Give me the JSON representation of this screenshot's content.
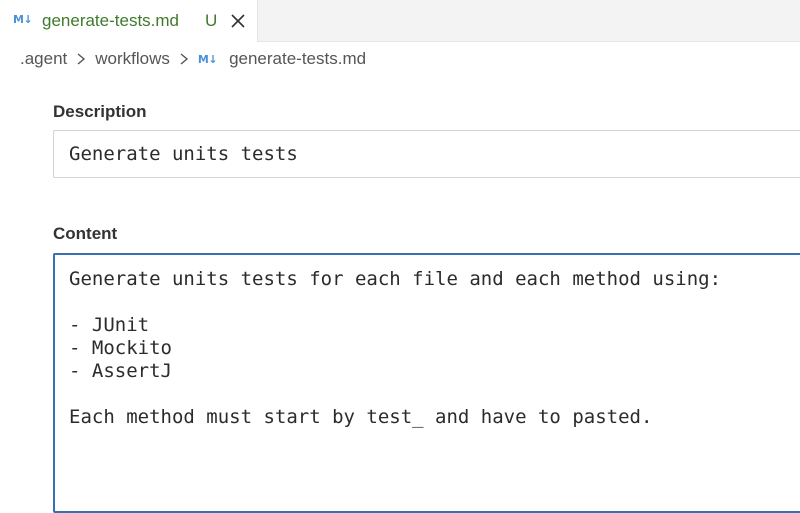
{
  "tab": {
    "icon": "M↓",
    "title": "generate-tests.md",
    "status": "U"
  },
  "breadcrumb": {
    "items": [
      ".agent",
      "workflows"
    ],
    "icon": "M↓",
    "file": "generate-tests.md"
  },
  "description": {
    "label": "Description",
    "value": "Generate units tests"
  },
  "content": {
    "label": "Content",
    "value": "Generate units tests for each file and each method using:\n\n- JUnit\n- Mockito\n- AssertJ\n\nEach method must start by test_ and have to pasted."
  },
  "colors": {
    "tab_text": "#3f7a2c",
    "markdown_icon": "#4a90d9",
    "focus_border": "#3a6fb3"
  }
}
